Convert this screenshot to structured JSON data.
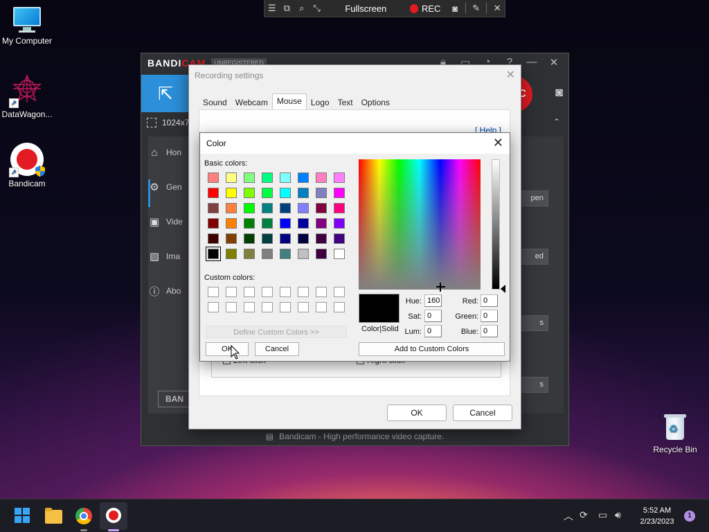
{
  "desktop": {
    "icons": [
      {
        "label": "My Computer"
      },
      {
        "label": "DataWagon..."
      },
      {
        "label": "Bandicam"
      }
    ],
    "recycle_bin": "Recycle Bin"
  },
  "rec_bar": {
    "fullscreen_label": "Fullscreen",
    "rec_label": "REC"
  },
  "bandicam": {
    "logo_part1": "BANDI",
    "logo_part2": "CAM",
    "unregistered": "UNREGISTERED",
    "rec_button": "REC",
    "resolution": "1024x7",
    "sidebar": [
      "Hon",
      "Gen",
      "Vide",
      "Ima",
      "Abo"
    ],
    "panel_buttons": [
      "pen",
      "ed",
      "s",
      "s"
    ],
    "banner": "BAN",
    "footer": "Bandicam - High performance video capture."
  },
  "recording_settings": {
    "title": "Recording settings",
    "tabs": [
      "Sound",
      "Webcam",
      "Mouse",
      "Logo",
      "Text",
      "Options"
    ],
    "active_tab": "Mouse",
    "help": "[ Help ]",
    "left_click": "Left click",
    "right_click": "Right click",
    "ok": "OK",
    "cancel": "Cancel"
  },
  "color_dialog": {
    "title": "Color",
    "basic_colors_label": "Basic colors:",
    "custom_colors_label": "Custom colors:",
    "basic_colors": [
      [
        "#ff8080",
        "#ffff80",
        "#80ff80",
        "#00ff80",
        "#80ffff",
        "#0080ff",
        "#ff80c0",
        "#ff80ff"
      ],
      [
        "#ff0000",
        "#ffff00",
        "#80ff00",
        "#00ff40",
        "#00ffff",
        "#0080c0",
        "#8080c0",
        "#ff00ff"
      ],
      [
        "#804040",
        "#ff8040",
        "#00ff00",
        "#008080",
        "#004080",
        "#8080ff",
        "#800040",
        "#ff0080"
      ],
      [
        "#800000",
        "#ff8000",
        "#008000",
        "#008040",
        "#0000ff",
        "#0000a0",
        "#800080",
        "#8000ff"
      ],
      [
        "#400000",
        "#804000",
        "#004000",
        "#004040",
        "#000080",
        "#000040",
        "#400040",
        "#400080"
      ],
      [
        "#000000",
        "#808000",
        "#808040",
        "#808080",
        "#408080",
        "#c0c0c0",
        "#400040",
        "#ffffff"
      ]
    ],
    "selected_basic": [
      5,
      0
    ],
    "define_custom": "Define Custom Colors >>",
    "ok": "OK",
    "cancel": "Cancel",
    "color_solid": "Color|Solid",
    "hue_label": "Hue:",
    "hue": "160",
    "sat_label": "Sat:",
    "sat": "0",
    "lum_label": "Lum:",
    "lum": "0",
    "red_label": "Red:",
    "red": "0",
    "green_label": "Green:",
    "green": "0",
    "blue_label": "Blue:",
    "blue": "0",
    "add_custom": "Add to Custom Colors",
    "current_color": "#000000"
  },
  "taskbar": {
    "time": "5:52 AM",
    "date": "2/23/2023",
    "notification_count": "1"
  }
}
